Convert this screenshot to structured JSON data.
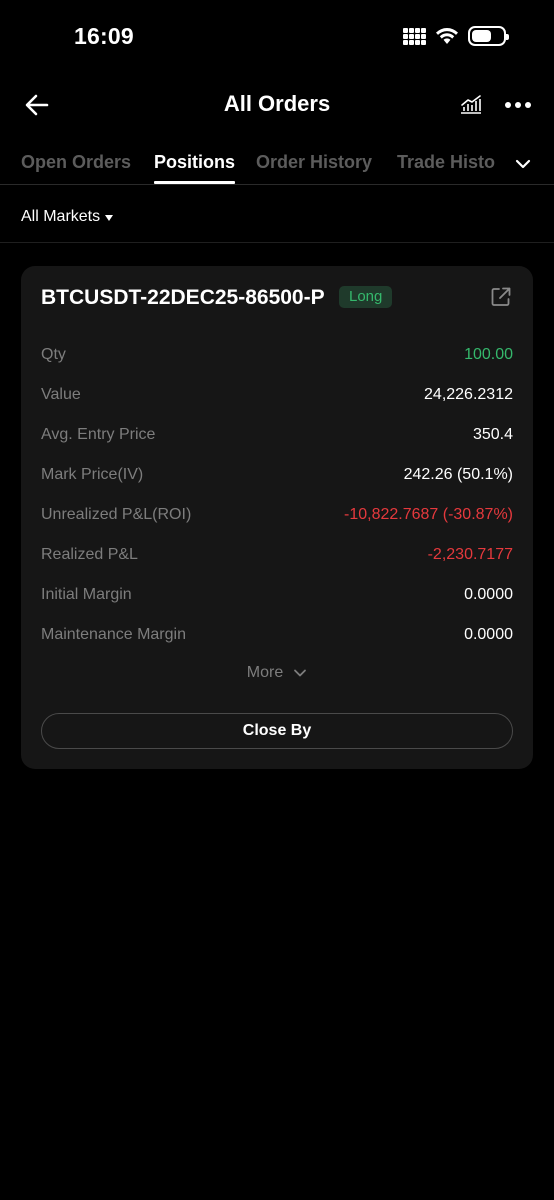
{
  "status_bar": {
    "time": "16:09"
  },
  "header": {
    "title": "All Orders",
    "back_icon": "back-arrow-icon",
    "chart_icon": "chart-icon",
    "more_icon": "more-dots-icon"
  },
  "tabs": [
    {
      "label": "Open Orders",
      "active": false
    },
    {
      "label": "Positions",
      "active": true
    },
    {
      "label": "Order History",
      "active": false
    },
    {
      "label": "Trade Histo",
      "active": false
    }
  ],
  "filter": {
    "label": "All Markets"
  },
  "position": {
    "symbol": "BTCUSDT-22DEC25-86500-P",
    "side": "Long",
    "rows": [
      {
        "label": "Qty",
        "value": "100.00",
        "color": "green"
      },
      {
        "label": "Value",
        "value": "24,226.2312",
        "color": "white"
      },
      {
        "label": "Avg. Entry Price",
        "value": "350.4",
        "color": "white"
      },
      {
        "label": "Mark Price(IV)",
        "value": "242.26 (50.1%)",
        "color": "white"
      },
      {
        "label": "Unrealized P&L(ROI)",
        "value": "-10,822.7687 (-30.87%)",
        "color": "red"
      },
      {
        "label": "Realized P&L",
        "value": "-2,230.7177",
        "color": "red"
      },
      {
        "label": "Initial Margin",
        "value": "0.0000",
        "color": "white"
      },
      {
        "label": "Maintenance Margin",
        "value": "0.0000",
        "color": "white"
      }
    ],
    "more_label": "More",
    "close_label": "Close By"
  },
  "colors": {
    "background": "#000000",
    "card": "#161616",
    "green": "#35b86c",
    "red": "#e5393d",
    "muted": "#7d7d7d"
  }
}
